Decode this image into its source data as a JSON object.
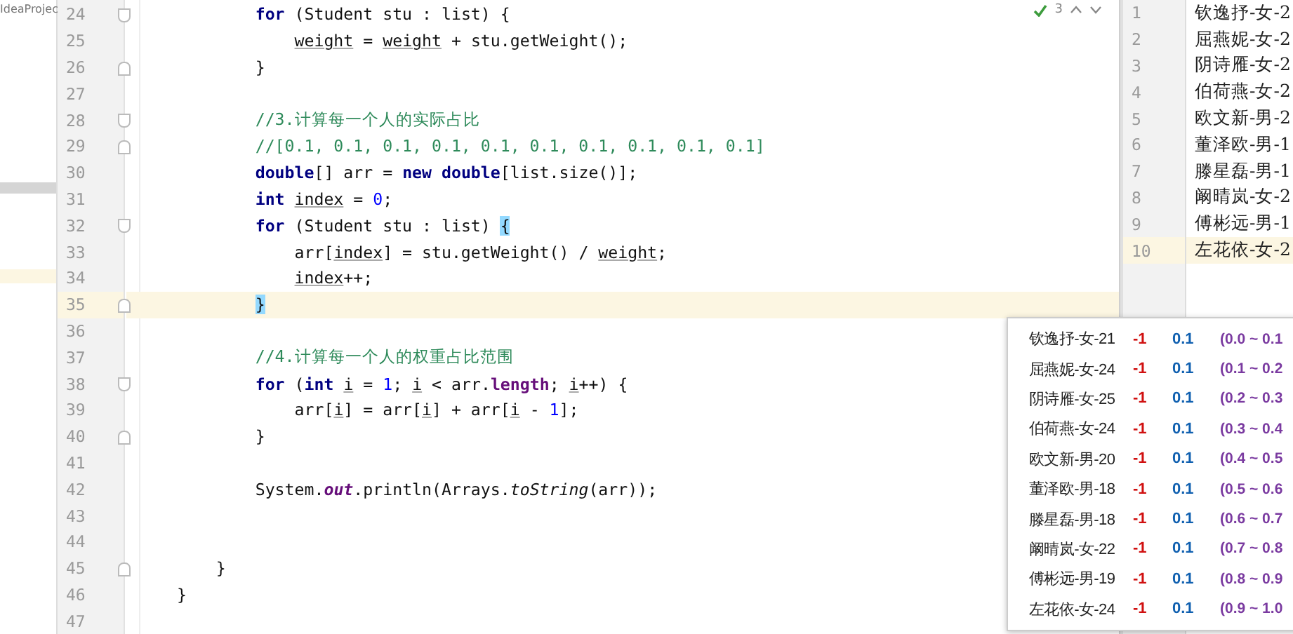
{
  "project_panel": {
    "label": "IdeaProjec"
  },
  "inspection_widget": {
    "count": "3"
  },
  "editor": {
    "lines": [
      {
        "number": "24",
        "fold_start": true,
        "fold_end": false,
        "current": false,
        "tokens": [
          {
            "kind": "kw",
            "text": "        for"
          },
          {
            "kind": "plain",
            "text": " (Student stu : list) {"
          }
        ]
      },
      {
        "number": "25",
        "fold_start": false,
        "fold_end": false,
        "current": false,
        "tokens": [
          {
            "kind": "var",
            "text": "            weight"
          },
          {
            "kind": "plain",
            "text": " = "
          },
          {
            "kind": "var",
            "text": "weight"
          },
          {
            "kind": "plain",
            "text": " + stu.getWeight();"
          }
        ]
      },
      {
        "number": "26",
        "fold_start": false,
        "fold_end": true,
        "current": false,
        "tokens": [
          {
            "kind": "plain",
            "text": "        }"
          }
        ]
      },
      {
        "number": "27",
        "fold_start": false,
        "fold_end": false,
        "current": false
      },
      {
        "number": "28",
        "fold_start": true,
        "fold_end": false,
        "current": false,
        "tokens": [
          {
            "kind": "comment",
            "text": "        //3.计算每一个人的实际占比"
          }
        ]
      },
      {
        "number": "29",
        "fold_start": false,
        "fold_end": true,
        "current": false,
        "tokens": [
          {
            "kind": "comment",
            "text": "        //[0.1, 0.1, 0.1, 0.1, 0.1, 0.1, 0.1, 0.1, 0.1, 0.1]"
          }
        ]
      },
      {
        "number": "30",
        "fold_start": false,
        "fold_end": false,
        "current": false,
        "tokens": [
          {
            "kind": "kw",
            "text": "        double"
          },
          {
            "kind": "plain",
            "text": "[] arr = "
          },
          {
            "kind": "kw",
            "text": "new double"
          },
          {
            "kind": "plain",
            "text": "[list.size()];"
          }
        ]
      },
      {
        "number": "31",
        "fold_start": false,
        "fold_end": false,
        "current": false,
        "tokens": [
          {
            "kind": "kw",
            "text": "        int "
          },
          {
            "kind": "var",
            "text": "index"
          },
          {
            "kind": "plain",
            "text": " = "
          },
          {
            "kind": "num",
            "text": "0"
          },
          {
            "kind": "plain",
            "text": ";"
          }
        ]
      },
      {
        "number": "32",
        "fold_start": true,
        "fold_end": false,
        "current": false,
        "tokens": [
          {
            "kind": "kw",
            "text": "        for"
          },
          {
            "kind": "plain",
            "text": " (Student stu : list) "
          },
          {
            "kind": "match",
            "text": "{"
          }
        ]
      },
      {
        "number": "33",
        "fold_start": false,
        "fold_end": false,
        "current": false,
        "tokens": [
          {
            "kind": "plain",
            "text": "            arr["
          },
          {
            "kind": "var",
            "text": "index"
          },
          {
            "kind": "plain",
            "text": "] = stu.getWeight() / "
          },
          {
            "kind": "var",
            "text": "weight"
          },
          {
            "kind": "plain",
            "text": ";"
          }
        ]
      },
      {
        "number": "34",
        "fold_start": false,
        "fold_end": false,
        "current": false,
        "tokens": [
          {
            "kind": "var",
            "text": "            index"
          },
          {
            "kind": "plain",
            "text": "++;"
          }
        ]
      },
      {
        "number": "35",
        "fold_start": false,
        "fold_end": true,
        "current": true,
        "tokens": [
          {
            "kind": "match",
            "text": "        }"
          }
        ]
      },
      {
        "number": "36",
        "fold_start": false,
        "fold_end": false,
        "current": false
      },
      {
        "number": "37",
        "fold_start": false,
        "fold_end": false,
        "current": false,
        "tokens": [
          {
            "kind": "comment",
            "text": "        //4.计算每一个人的权重占比范围"
          }
        ]
      },
      {
        "number": "38",
        "fold_start": true,
        "fold_end": false,
        "current": false,
        "tokens": [
          {
            "kind": "kw",
            "text": "        for"
          },
          {
            "kind": "plain",
            "text": " ("
          },
          {
            "kind": "kw",
            "text": "int "
          },
          {
            "kind": "var",
            "text": "i"
          },
          {
            "kind": "plain",
            "text": " = "
          },
          {
            "kind": "num",
            "text": "1"
          },
          {
            "kind": "plain",
            "text": "; "
          },
          {
            "kind": "var",
            "text": "i"
          },
          {
            "kind": "plain",
            "text": " < arr."
          },
          {
            "kind": "field",
            "text": "length"
          },
          {
            "kind": "plain",
            "text": "; "
          },
          {
            "kind": "var",
            "text": "i"
          },
          {
            "kind": "plain",
            "text": "++) {"
          }
        ]
      },
      {
        "number": "39",
        "fold_start": false,
        "fold_end": false,
        "current": false,
        "tokens": [
          {
            "kind": "plain",
            "text": "            arr["
          },
          {
            "kind": "var",
            "text": "i"
          },
          {
            "kind": "plain",
            "text": "] = arr["
          },
          {
            "kind": "var",
            "text": "i"
          },
          {
            "kind": "plain",
            "text": "] + arr["
          },
          {
            "kind": "var",
            "text": "i"
          },
          {
            "kind": "plain",
            "text": " - "
          },
          {
            "kind": "num",
            "text": "1"
          },
          {
            "kind": "plain",
            "text": "];"
          }
        ]
      },
      {
        "number": "40",
        "fold_start": false,
        "fold_end": true,
        "current": false,
        "tokens": [
          {
            "kind": "plain",
            "text": "        }"
          }
        ]
      },
      {
        "number": "41",
        "fold_start": false,
        "fold_end": false,
        "current": false
      },
      {
        "number": "42",
        "fold_start": false,
        "fold_end": false,
        "current": false,
        "tokens": [
          {
            "kind": "plain",
            "text": "        System."
          },
          {
            "kind": "static",
            "text": "out"
          },
          {
            "kind": "plain",
            "text": ".println(Arrays."
          },
          {
            "kind": "italic",
            "text": "toString"
          },
          {
            "kind": "plain",
            "text": "(arr));"
          }
        ]
      },
      {
        "number": "43",
        "fold_start": false,
        "fold_end": false,
        "current": false
      },
      {
        "number": "44",
        "fold_start": false,
        "fold_end": false,
        "current": false
      },
      {
        "number": "45",
        "fold_start": false,
        "fold_end": true,
        "current": false,
        "tokens": [
          {
            "kind": "plain",
            "text": "    }"
          }
        ]
      },
      {
        "number": "46",
        "fold_start": false,
        "fold_end": false,
        "current": false,
        "tokens": [
          {
            "kind": "plain",
            "text": "}"
          }
        ]
      },
      {
        "number": "47",
        "fold_start": false,
        "fold_end": false,
        "current": false
      }
    ]
  },
  "data_file": {
    "lines": [
      {
        "number": "1",
        "text": "钦逸抒-女-2",
        "current": false
      },
      {
        "number": "2",
        "text": "屈燕妮-女-2",
        "current": false
      },
      {
        "number": "3",
        "text": "阴诗雁-女-2",
        "current": false
      },
      {
        "number": "4",
        "text": "伯荷燕-女-2",
        "current": false
      },
      {
        "number": "5",
        "text": "欧文新-男-2",
        "current": false
      },
      {
        "number": "6",
        "text": "董泽欧-男-1",
        "current": false
      },
      {
        "number": "7",
        "text": "滕星磊-男-1",
        "current": false
      },
      {
        "number": "8",
        "text": "阚晴岚-女-2",
        "current": false
      },
      {
        "number": "9",
        "text": "傅彬远-男-1",
        "current": false
      },
      {
        "number": "10",
        "text": "左花依-女-2",
        "current": true
      }
    ]
  },
  "popup": {
    "rows": [
      {
        "name": "钦逸抒-女-21",
        "delta": "-1",
        "weight": "0.1",
        "range": "(0.0 ~ 0.1"
      },
      {
        "name": "屈燕妮-女-24",
        "delta": "-1",
        "weight": "0.1",
        "range": "(0.1 ~ 0.2"
      },
      {
        "name": "阴诗雁-女-25",
        "delta": "-1",
        "weight": "0.1",
        "range": "(0.2 ~ 0.3"
      },
      {
        "name": "伯荷燕-女-24",
        "delta": "-1",
        "weight": "0.1",
        "range": "(0.3 ~ 0.4"
      },
      {
        "name": "欧文新-男-20",
        "delta": "-1",
        "weight": "0.1",
        "range": "(0.4 ~ 0.5"
      },
      {
        "name": "董泽欧-男-18",
        "delta": "-1",
        "weight": "0.1",
        "range": "(0.5 ~ 0.6"
      },
      {
        "name": "滕星磊-男-18",
        "delta": "-1",
        "weight": "0.1",
        "range": "(0.6 ~ 0.7"
      },
      {
        "name": "阚晴岚-女-22",
        "delta": "-1",
        "weight": "0.1",
        "range": "(0.7 ~ 0.8"
      },
      {
        "name": "傅彬远-男-19",
        "delta": "-1",
        "weight": "0.1",
        "range": "(0.8 ~ 0.9"
      },
      {
        "name": "左花依-女-24",
        "delta": "-1",
        "weight": "0.1",
        "range": "(0.9 ~ 1.0"
      }
    ]
  }
}
